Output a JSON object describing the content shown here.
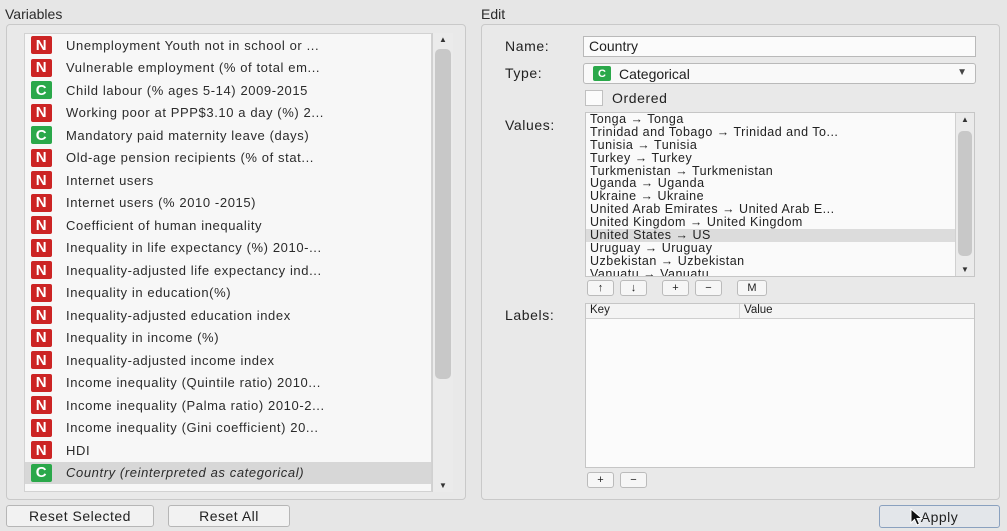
{
  "variables_title": "Variables",
  "edit_title": "Edit",
  "variables": [
    {
      "type": "N",
      "label": "Unemployment Youth not in school or ..."
    },
    {
      "type": "N",
      "label": "Vulnerable employment (% of total em..."
    },
    {
      "type": "C",
      "label": "Child labour  (% ages 5-14) 2009-2015"
    },
    {
      "type": "N",
      "label": "Working poor at PPP$3.10 a day (%) 2..."
    },
    {
      "type": "C",
      "label": "Mandatory paid maternity leave (days)"
    },
    {
      "type": "N",
      "label": "Old-age pension recipients  (% of stat..."
    },
    {
      "type": "N",
      "label": "Internet users"
    },
    {
      "type": "N",
      "label": "Internet users (% 2010 -2015)"
    },
    {
      "type": "N",
      "label": "Coefficient of human inequality"
    },
    {
      "type": "N",
      "label": "Inequality in life expectancy (%) 2010-..."
    },
    {
      "type": "N",
      "label": "Inequality-adjusted life expectancy ind..."
    },
    {
      "type": "N",
      "label": "Inequality in education(%)"
    },
    {
      "type": "N",
      "label": "Inequality-adjusted education index"
    },
    {
      "type": "N",
      "label": "Inequality in income (%)"
    },
    {
      "type": "N",
      "label": "Inequality-adjusted income index"
    },
    {
      "type": "N",
      "label": "Income inequality (Quintile ratio) 2010..."
    },
    {
      "type": "N",
      "label": "Income inequality (Palma ratio) 2010-2..."
    },
    {
      "type": "N",
      "label": "Income inequality (Gini coefficient) 20..."
    },
    {
      "type": "N",
      "label": "HDI"
    },
    {
      "type": "C",
      "label": "Country (reinterpreted as categorical)",
      "selected": true
    }
  ],
  "buttons": {
    "reset_selected": "Reset Selected",
    "reset_all": "Reset All",
    "apply": "Apply"
  },
  "edit": {
    "name_label": "Name:",
    "name_value": "Country",
    "type_label": "Type:",
    "type_badge": "C",
    "type_value": "Categorical",
    "ordered_label": "Ordered",
    "values_label": "Values:",
    "labels_label": "Labels:",
    "labels_key_header": "Key",
    "labels_value_header": "Value"
  },
  "values": [
    {
      "text": "Tonga → Tonga"
    },
    {
      "text": "Trinidad and Tobago → Trinidad and To..."
    },
    {
      "text": "Tunisia → Tunisia"
    },
    {
      "text": "Turkey → Turkey"
    },
    {
      "text": "Turkmenistan → Turkmenistan"
    },
    {
      "text": "Uganda → Uganda"
    },
    {
      "text": "Ukraine → Ukraine"
    },
    {
      "text": "United Arab Emirates → United Arab E..."
    },
    {
      "text": "United Kingdom → United Kingdom"
    },
    {
      "text": "United States → US",
      "selected": true
    },
    {
      "text": "Uruguay → Uruguay"
    },
    {
      "text": "Uzbekistan → Uzbekistan"
    },
    {
      "text": "Vanuatu → Vanuatu"
    }
  ],
  "value_buttons": {
    "up": "↑",
    "down": "↓",
    "add": "+",
    "remove": "−",
    "merge": "M"
  },
  "label_buttons": {
    "add": "+",
    "remove": "−"
  },
  "colors": {
    "numeric_badge": "#cc2424",
    "categorical_badge": "#2aa84a"
  }
}
